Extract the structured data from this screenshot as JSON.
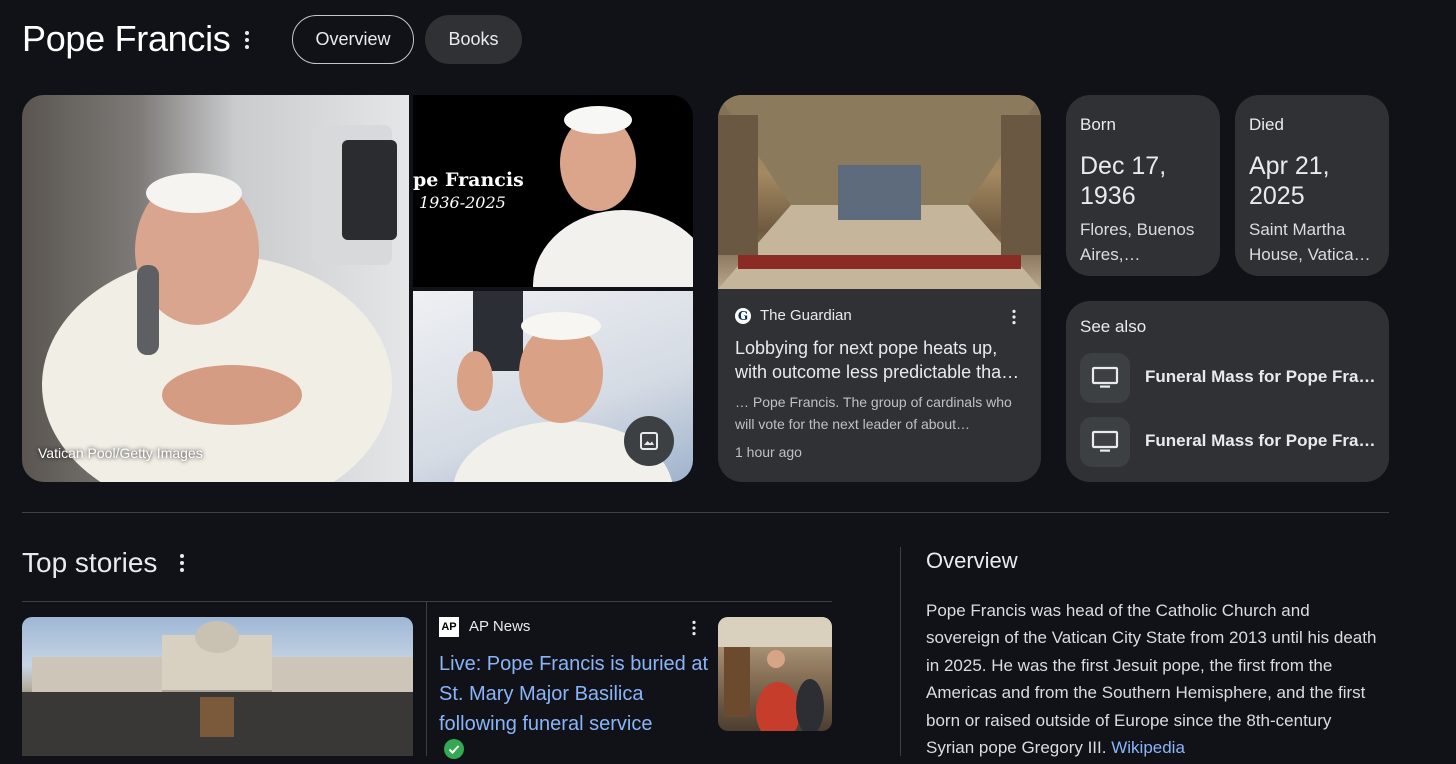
{
  "header": {
    "title": "Pope Francis",
    "tabs": [
      {
        "label": "Overview",
        "active": true
      },
      {
        "label": "Books",
        "active": false
      }
    ]
  },
  "gallery": {
    "main_caption": "Vatican Pool/Getty Images",
    "tribute_text_line1": "pe Francis",
    "tribute_text_line2": "1936-2025",
    "images_icon": "image-gallery-icon"
  },
  "news_card": {
    "source": "The Guardian",
    "source_logo": "G",
    "headline": "Lobbying for next pope heats up, with outcome less predictable tha…",
    "snippet": "… Pope Francis. The group of cardinals who will vote for the next leader of about…",
    "time": "1 hour ago"
  },
  "facts": {
    "born": {
      "label": "Born",
      "date": "Dec 17, 1936",
      "place": "Flores, Buenos Aires,…"
    },
    "died": {
      "label": "Died",
      "date": "Apr 21, 2025",
      "place": "Saint Martha House, Vatica…"
    }
  },
  "see_also": {
    "title": "See also",
    "items": [
      {
        "label": "Funeral Mass for Pope Fra…",
        "icon": "tv-icon"
      },
      {
        "label": "Funeral Mass for Pope Fra…",
        "icon": "tv-icon"
      }
    ]
  },
  "top_stories": {
    "title": "Top stories",
    "story": {
      "source": "AP News",
      "source_logo": "AP",
      "headline_line1": "Live: Pope Francis is buried at",
      "headline_line2": "St. Mary Major Basilica",
      "headline_line3": "following funeral service"
    }
  },
  "overview": {
    "title": "Overview",
    "lines": [
      "Pope Francis was head of the Catholic Church and",
      "sovereign of the Vatican City State from 2013 until his death",
      "in 2025. He was the first Jesuit pope, the first from the",
      "Americas and from the Southern Hemisphere, and the first",
      "born or raised outside of Europe since the 8th-century",
      "Syrian pope Gregory III."
    ],
    "source_link": "Wikipedia"
  },
  "colors": {
    "background": "#101218",
    "card": "#303134",
    "link": "#8ab4f8",
    "text": "#e8eaed"
  }
}
